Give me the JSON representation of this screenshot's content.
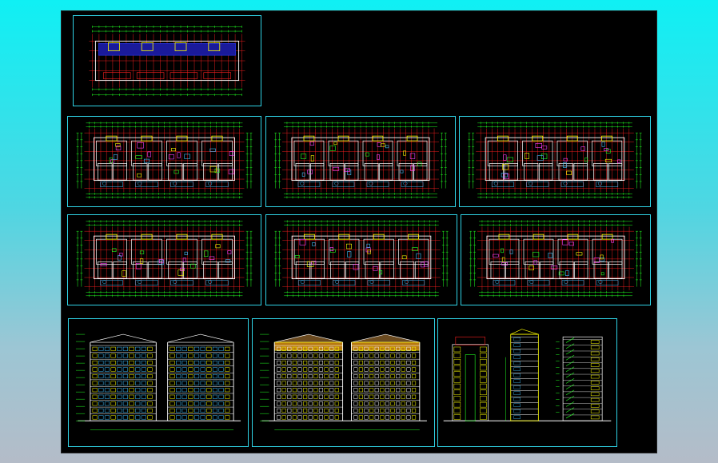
{
  "drawing": {
    "sheet_color": "#000000",
    "frame_color": "#2fd3e6",
    "palette": {
      "axis": "#ff2020",
      "wall": "#ffffff",
      "dimension": "#22ff22",
      "accent": "#ffff00",
      "furniture": "#ff40ff",
      "detail": "#40c0ff"
    },
    "plans": [
      {
        "id": "plan-1",
        "caption": ""
      },
      {
        "id": "plan-2",
        "caption": ""
      },
      {
        "id": "plan-3",
        "caption": ""
      },
      {
        "id": "plan-4",
        "caption": ""
      },
      {
        "id": "plan-5",
        "caption": ""
      },
      {
        "id": "plan-6",
        "caption": ""
      },
      {
        "id": "plan-7",
        "caption": ""
      }
    ],
    "elevations": [
      {
        "id": "elevation-1",
        "caption": ""
      },
      {
        "id": "elevation-2",
        "caption": ""
      },
      {
        "id": "sections",
        "caption": ""
      }
    ]
  }
}
